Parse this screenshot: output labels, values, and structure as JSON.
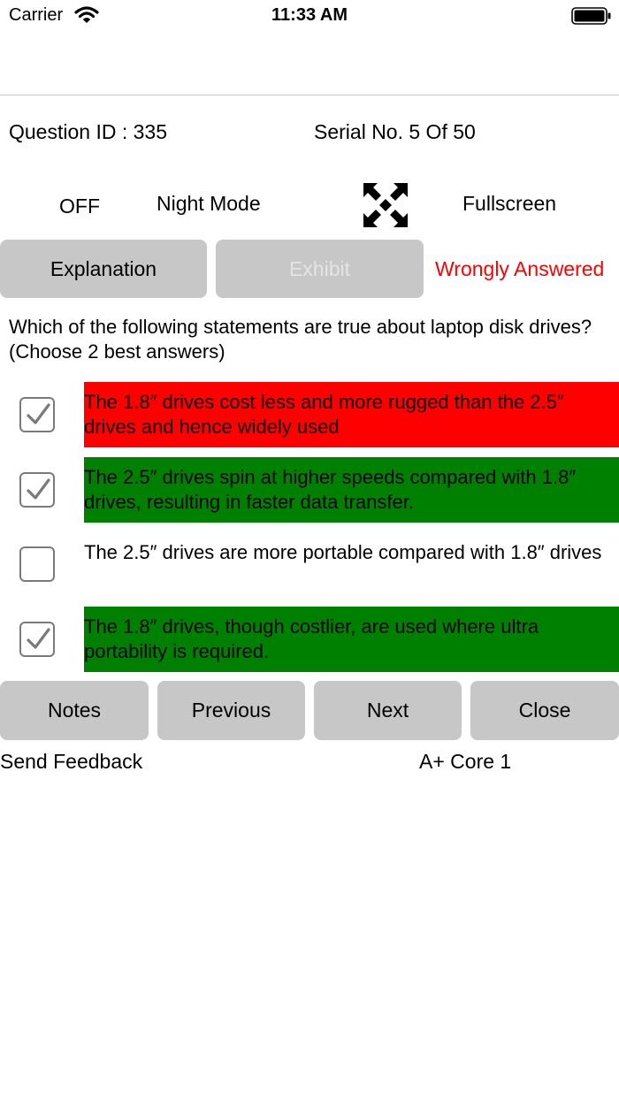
{
  "status_bar": {
    "carrier": "Carrier",
    "time": "11:33 AM",
    "wifi_icon": "wifi-icon",
    "battery_icon": "battery-icon"
  },
  "info": {
    "question_id": "Question ID : 335",
    "serial": "Serial No. 5 Of 50"
  },
  "controls": {
    "night_mode_state": "OFF",
    "night_mode_label": "Night Mode",
    "fullscreen_icon": "fullscreen-icon",
    "fullscreen_label": "Fullscreen"
  },
  "action_buttons": {
    "explanation": "Explanation",
    "exhibit": "Exhibit",
    "result": "Wrongly Answered"
  },
  "question": {
    "text": "Which of the following statements are true about laptop disk drives? (Choose 2 best answers)"
  },
  "options": [
    {
      "text": "The 1.8″ drives cost less and more rugged than the 2.5″ drives and hence widely used",
      "checked": true,
      "status": "wrong",
      "color": "#ff0000"
    },
    {
      "text": "The 2.5″ drives spin at higher speeds compared with 1.8″ drives, resulting in faster data transfer.",
      "checked": true,
      "status": "correct",
      "color": "#008000"
    },
    {
      "text": "The 2.5″ drives are more portable compared with 1.8″ drives",
      "checked": false,
      "status": "none",
      "color": "#ffffff"
    },
    {
      "text": "The 1.8″ drives, though costlier, are used where ultra portability is required.",
      "checked": true,
      "status": "correct",
      "color": "#008000"
    }
  ],
  "nav": {
    "notes": "Notes",
    "previous": "Previous",
    "next": "Next",
    "close": "Close"
  },
  "footer": {
    "send_feedback": "Send Feedback",
    "exam_name": "A+ Core 1"
  }
}
